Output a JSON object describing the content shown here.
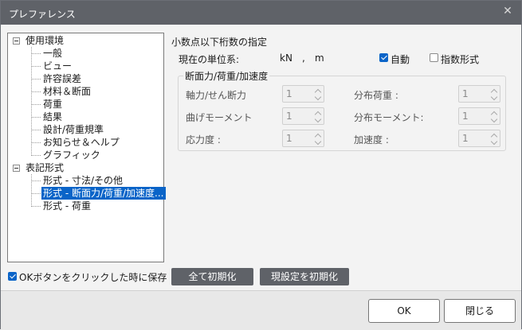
{
  "window": {
    "title": "プレファレンス"
  },
  "tree": {
    "group1": {
      "label": "使用環境",
      "items": [
        "一般",
        "ビュー",
        "許容誤差",
        "材料＆断面",
        "荷重",
        "結果",
        "設計/荷重規準",
        "お知らせ＆ヘルプ",
        "グラフィック"
      ]
    },
    "group2": {
      "label": "表記形式",
      "items": [
        "形式 - 寸法/その他",
        "形式 - 断面力/荷重/加速度...",
        "形式 - 荷重"
      ]
    }
  },
  "main": {
    "section_title": "小数点以下桁数の指定",
    "unit_label": "現在の単位系:",
    "unit_force": "kN",
    "unit_sep": ",",
    "unit_length": "m",
    "auto_label": "自動",
    "exponent_label": "指数形式",
    "group_title": "断面力/荷重/加速度",
    "fields": [
      {
        "label": "軸力/せん断力",
        "value": "1"
      },
      {
        "label": "分布荷重 :",
        "value": "1"
      },
      {
        "label": "曲げモーメント",
        "value": "1"
      },
      {
        "label": "分布モーメント:",
        "value": "1"
      },
      {
        "label": "応力度 :",
        "value": "1"
      },
      {
        "label": "加速度 :",
        "value": "1"
      }
    ]
  },
  "bottom": {
    "save_label": "OKボタンをクリックした時に保存",
    "reset_all": "全て初期化",
    "reset_current": "現設定を初期化",
    "ok": "OK",
    "close": "閉じる"
  }
}
